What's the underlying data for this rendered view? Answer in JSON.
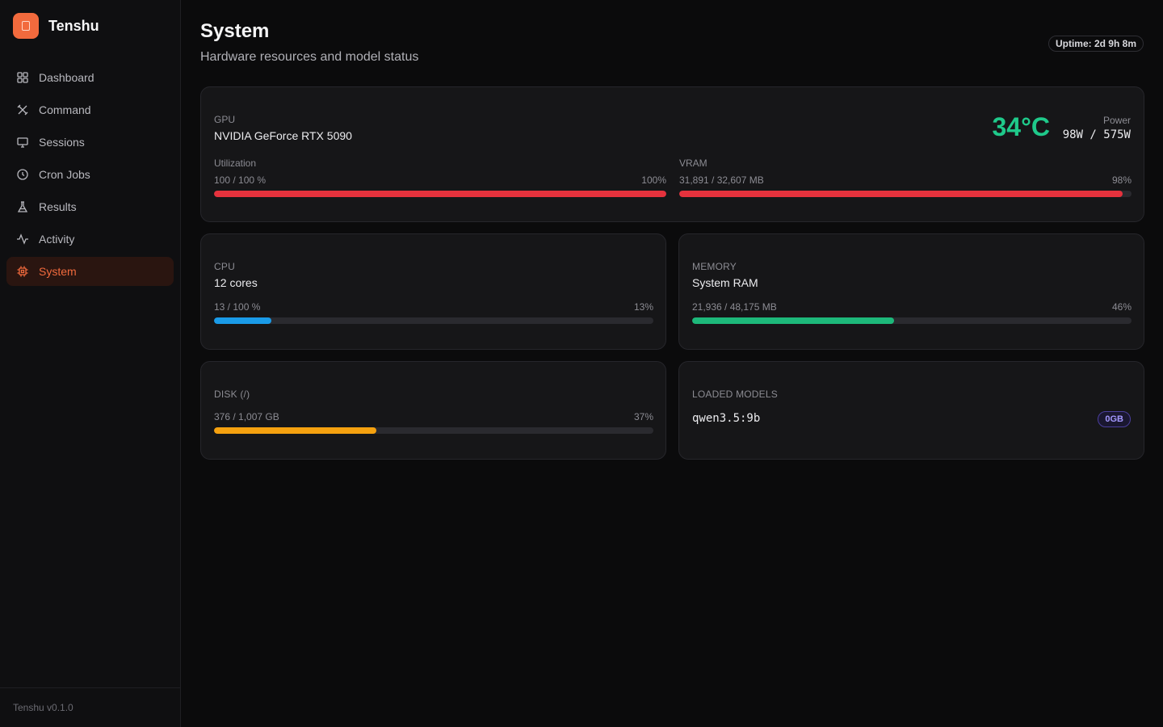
{
  "brand": {
    "name": "Tenshu",
    "version": "Tenshu v0.1.0",
    "accent": "#f26a3d"
  },
  "nav": [
    {
      "label": "Dashboard",
      "icon": "dashboard-icon",
      "active": false
    },
    {
      "label": "Command",
      "icon": "command-icon",
      "active": false
    },
    {
      "label": "Sessions",
      "icon": "monitor-icon",
      "active": false
    },
    {
      "label": "Cron Jobs",
      "icon": "clock-icon",
      "active": false
    },
    {
      "label": "Results",
      "icon": "flask-icon",
      "active": false
    },
    {
      "label": "Activity",
      "icon": "activity-icon",
      "active": false
    },
    {
      "label": "System",
      "icon": "chip-icon",
      "active": true
    }
  ],
  "header": {
    "title": "System",
    "subtitle": "Hardware resources and model status",
    "uptime": "Uptime: 2d 9h 8m"
  },
  "gpu": {
    "label": "GPU",
    "name": "NVIDIA GeForce RTX 5090",
    "temperature": "34°C",
    "temperature_color": "#1fc98a",
    "power_label": "Power",
    "power_value": "98W / 575W",
    "utilization": {
      "label": "Utilization",
      "detail": "100 / 100 %",
      "percent_text": "100%",
      "percent": 100,
      "color": "#e5323d"
    },
    "vram": {
      "label": "VRAM",
      "detail": "31,891 / 32,607 MB",
      "percent_text": "98%",
      "percent": 98,
      "color": "#e5323d"
    }
  },
  "cpu": {
    "label": "CPU",
    "name": "12 cores",
    "detail": "13 / 100 %",
    "percent_text": "13%",
    "percent": 13,
    "color": "#1a9be8"
  },
  "memory": {
    "label": "MEMORY",
    "name": "System RAM",
    "detail": "21,936 / 48,175 MB",
    "percent_text": "46%",
    "percent": 46,
    "color": "#1db87a"
  },
  "disk": {
    "label": "DISK (/)",
    "detail": "376 / 1,007 GB",
    "percent_text": "37%",
    "percent": 37,
    "color": "#f5a10f"
  },
  "models": {
    "label": "LOADED MODELS",
    "items": [
      {
        "name": "qwen3.5:9b",
        "size": "0GB"
      }
    ]
  }
}
